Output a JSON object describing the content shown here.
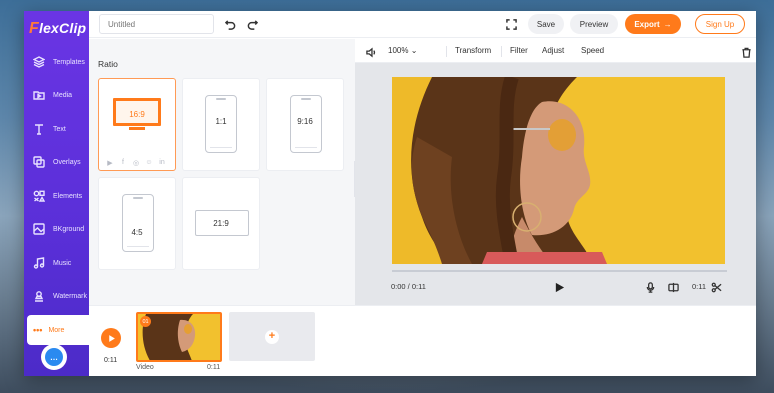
{
  "app": {
    "logo_f": "F",
    "logo_rest": "lexClip"
  },
  "topbar": {
    "title_placeholder": "Untitled",
    "save_label": "Save",
    "preview_label": "Preview",
    "export_label": "Export",
    "signup_label": "Sign Up"
  },
  "sidebar": {
    "items": [
      {
        "label": "Templates",
        "icon": "layers-icon"
      },
      {
        "label": "Media",
        "icon": "folder-play-icon"
      },
      {
        "label": "Text",
        "icon": "text-icon"
      },
      {
        "label": "Overlays",
        "icon": "overlays-icon"
      },
      {
        "label": "Elements",
        "icon": "elements-icon"
      },
      {
        "label": "BKground",
        "icon": "background-icon"
      },
      {
        "label": "Music",
        "icon": "music-icon"
      },
      {
        "label": "Watermark",
        "icon": "watermark-icon"
      },
      {
        "label": "More",
        "icon": "more-dots-icon"
      }
    ],
    "more_dots": "•••",
    "chat_icon": "chat-bubble-icon"
  },
  "ratio_panel": {
    "title": "Ratio",
    "options": [
      {
        "label": "16:9",
        "selected": true
      },
      {
        "label": "1:1",
        "selected": false
      },
      {
        "label": "9:16",
        "selected": false
      },
      {
        "label": "4:5",
        "selected": false
      },
      {
        "label": "21:9",
        "selected": false
      }
    ],
    "social_icons": [
      "youtube-icon",
      "facebook-icon",
      "instagram-icon",
      "snapchat-icon",
      "linkedin-icon"
    ],
    "social_glyphs": [
      "▶",
      "f",
      "◎",
      "☺",
      "in"
    ]
  },
  "preview_toolbar": {
    "zoom": "100%",
    "transform_label": "Transform",
    "filter_label": "Filter",
    "adjust_label": "Adjust",
    "speed_label": "Speed"
  },
  "player": {
    "current_time": "0:00 / 0:11",
    "duration": "0:11"
  },
  "timeline": {
    "total_time": "0:11",
    "clip_number": "01",
    "clip_label": "Video",
    "clip_duration": "0:11"
  },
  "colors": {
    "accent": "#ff7a1a",
    "sidebar": "#5a2fd8",
    "video_bg": "#f2c12e"
  }
}
